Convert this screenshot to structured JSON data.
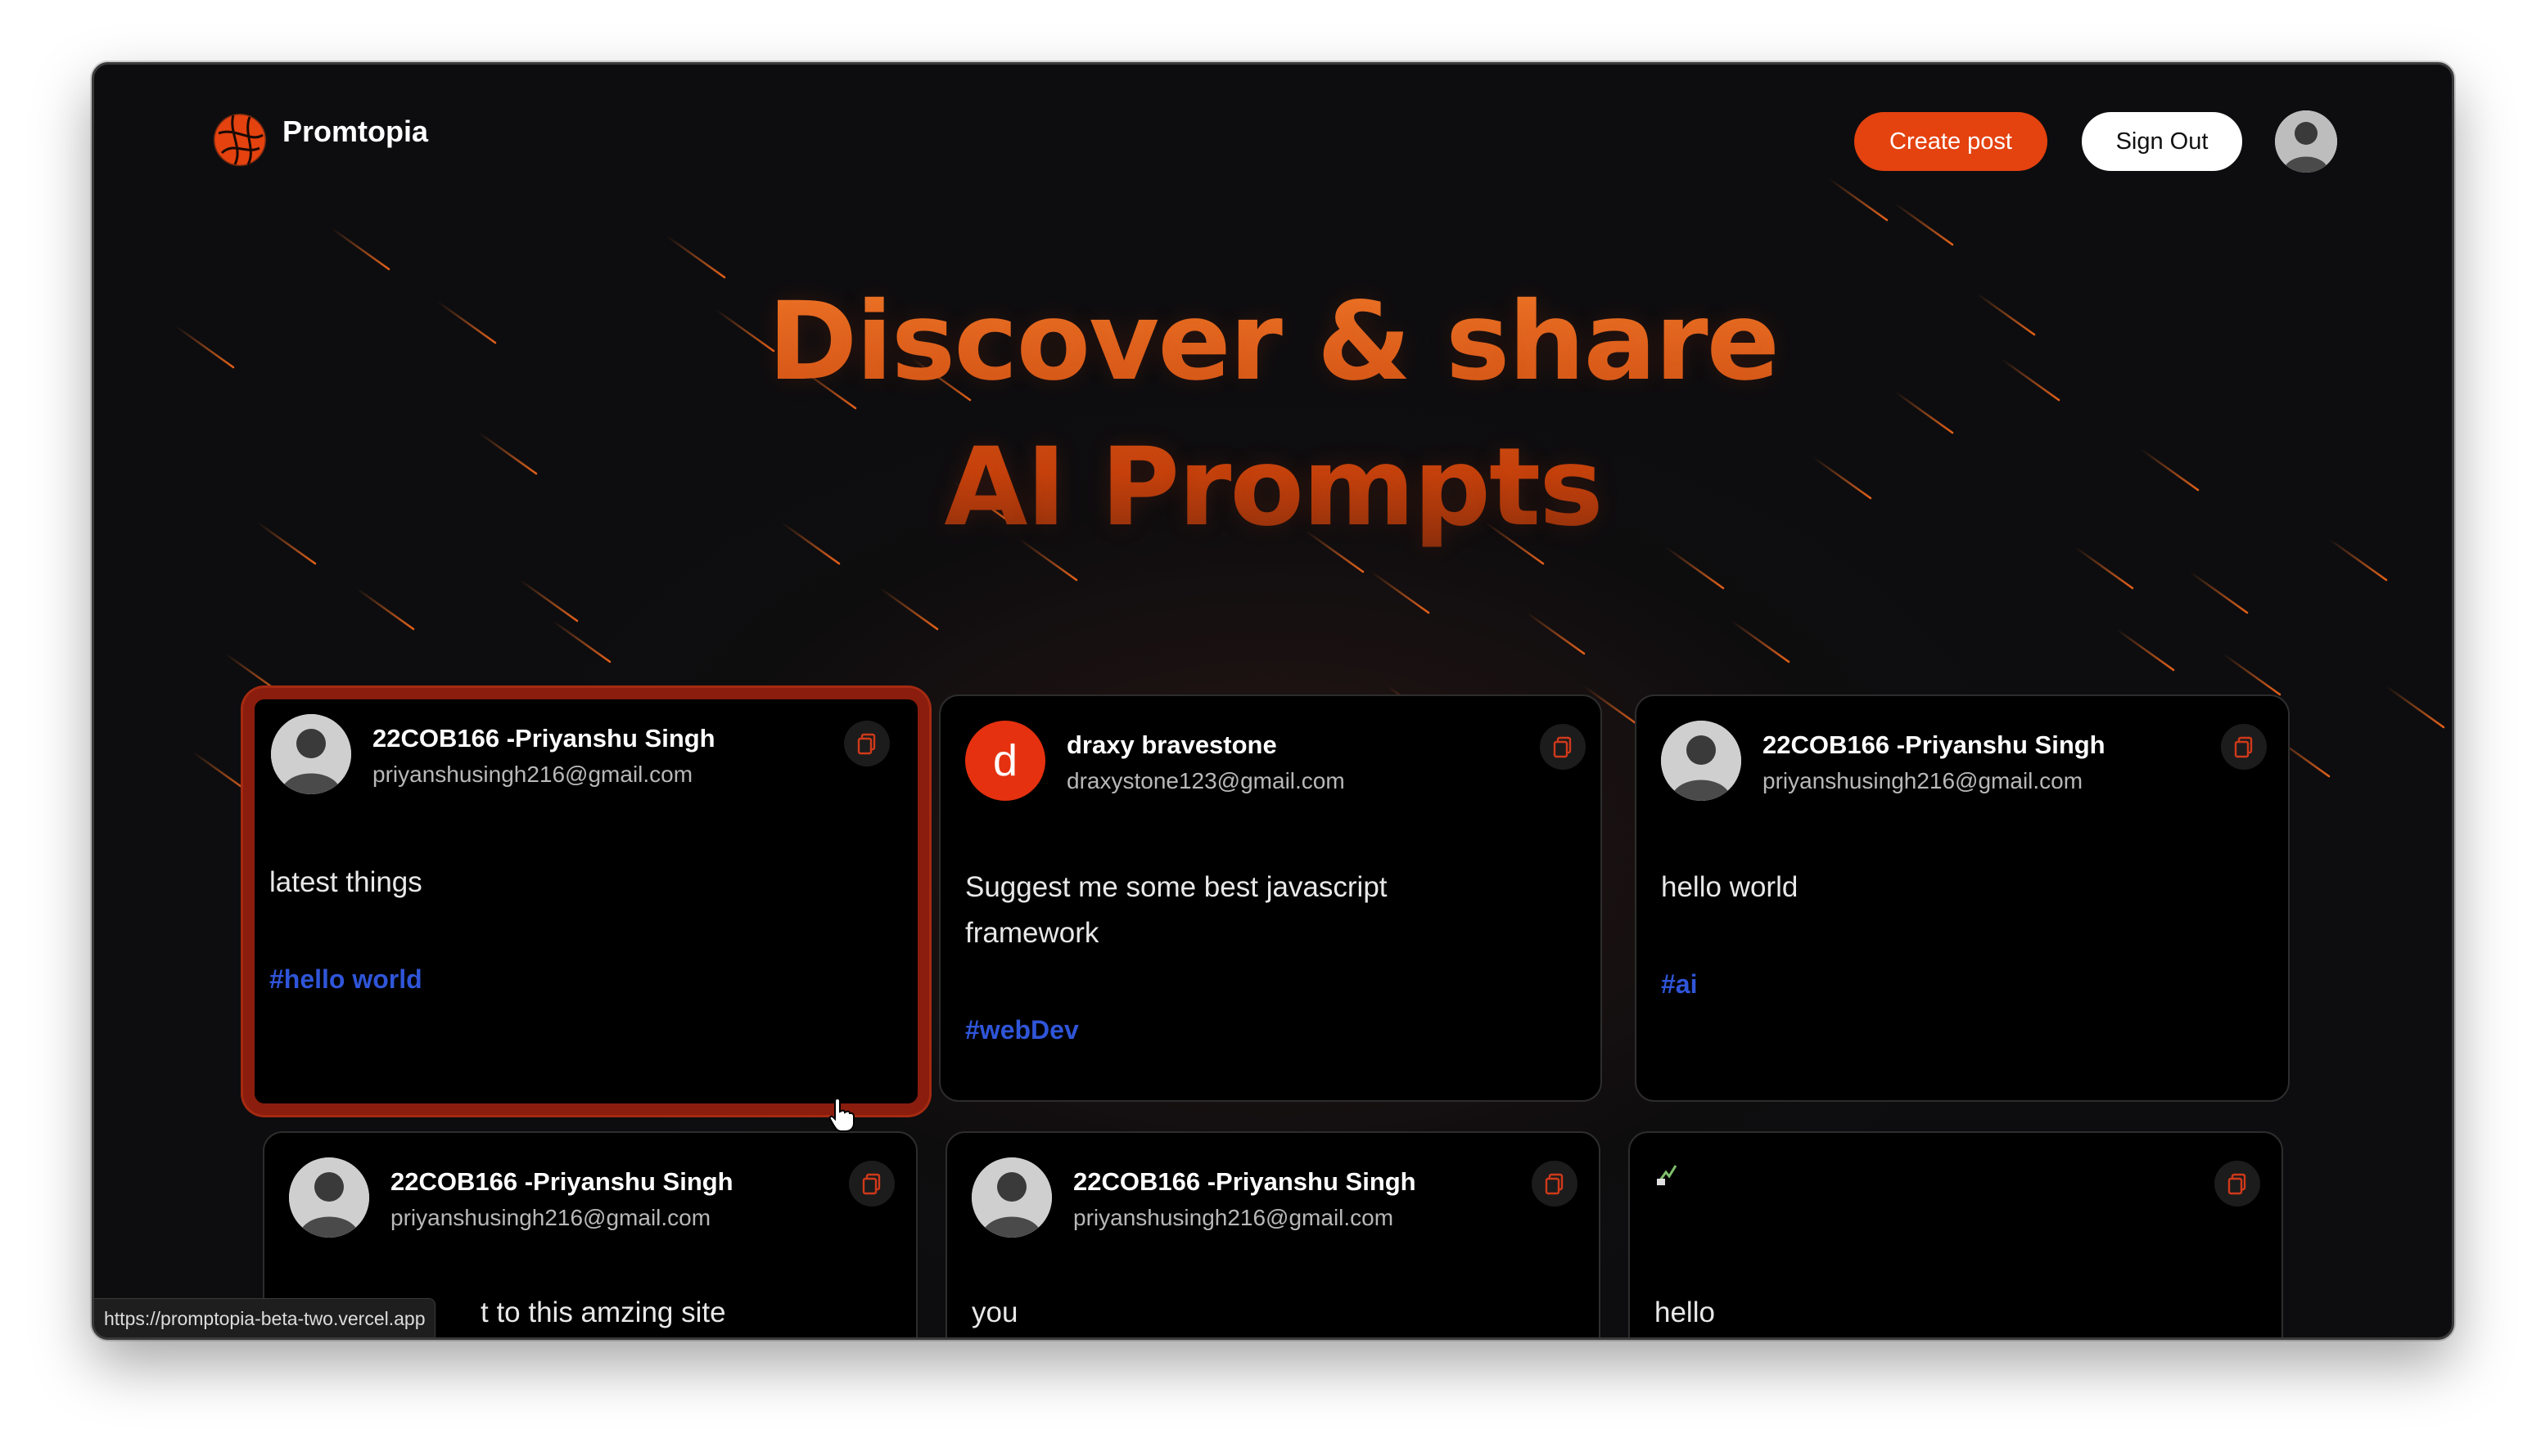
{
  "app": {
    "brand": "Promtopia",
    "accent": "#e4420f"
  },
  "nav": {
    "create_label": "Create post",
    "signout_label": "Sign Out",
    "avatar_icon": "user-photo"
  },
  "hero": {
    "line1": "Discover & share",
    "line2": "AI Prompts"
  },
  "cards": [
    {
      "name": "22COB166 -Priyanshu Singh",
      "email": "priyanshusingh216@gmail.com",
      "prompt": "latest things",
      "tag": "#hello world",
      "avatar": "photo"
    },
    {
      "name": "draxy bravestone",
      "email": "draxystone123@gmail.com",
      "prompt": "Suggest me some best javascript framework",
      "tag": "#webDev",
      "avatar": "d"
    },
    {
      "name": "22COB166 -Priyanshu Singh",
      "email": "priyanshusingh216@gmail.com",
      "prompt": "hello world",
      "tag": "#ai",
      "avatar": "photo"
    },
    {
      "name": "22COB166 -Priyanshu Singh",
      "email": "priyanshusingh216@gmail.com",
      "prompt": "t to this amzing site",
      "tag": "",
      "avatar": "photo"
    },
    {
      "name": "22COB166 -Priyanshu Singh",
      "email": "priyanshusingh216@gmail.com",
      "prompt": "you",
      "tag": "",
      "avatar": "photo"
    },
    {
      "name": "",
      "email": "",
      "prompt": "hello",
      "tag": "",
      "avatar": "broken-image"
    }
  ],
  "status_url": "https://promptopia-beta-two.vercel.app"
}
